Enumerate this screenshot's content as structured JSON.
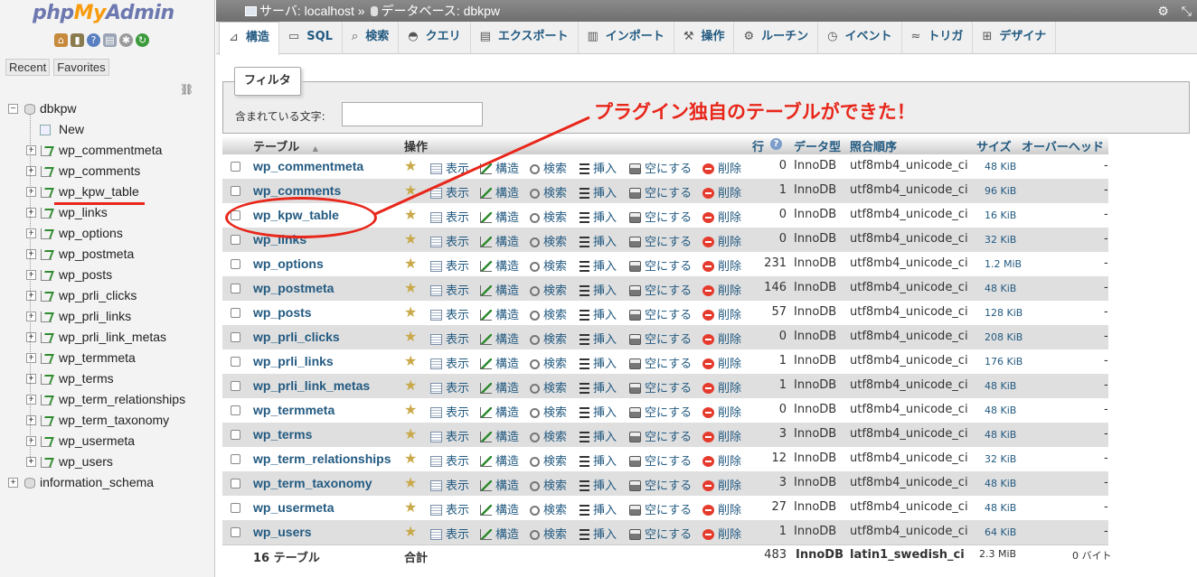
{
  "app": {
    "logo": {
      "php": "php",
      "my": "My",
      "admin": "Admin"
    },
    "nav_icons": [
      "home-icon",
      "logout-icon",
      "help-icon",
      "docs-icon",
      "settings-icon",
      "reload-icon"
    ],
    "recent_tabs": [
      "Recent",
      "Favorites"
    ]
  },
  "sidebar": {
    "databases": [
      {
        "name": "dbkpw",
        "expanded": true
      },
      {
        "name": "information_schema",
        "expanded": false
      }
    ],
    "new_label": "New",
    "tables": [
      "wp_commentmeta",
      "wp_comments",
      "wp_kpw_table",
      "wp_links",
      "wp_options",
      "wp_postmeta",
      "wp_posts",
      "wp_prli_clicks",
      "wp_prli_links",
      "wp_prli_link_metas",
      "wp_termmeta",
      "wp_terms",
      "wp_term_relationships",
      "wp_term_taxonomy",
      "wp_usermeta",
      "wp_users"
    ]
  },
  "breadcrumb": {
    "server": "サーバ: localhost",
    "sep": "»",
    "database": "データベース: dbkpw"
  },
  "tabs": [
    {
      "label": "構造",
      "icon": "structure-icon",
      "active": true
    },
    {
      "label": "SQL",
      "icon": "sql-icon"
    },
    {
      "label": "検索",
      "icon": "search-icon"
    },
    {
      "label": "クエリ",
      "icon": "query-icon"
    },
    {
      "label": "エクスポート",
      "icon": "export-icon"
    },
    {
      "label": "インポート",
      "icon": "import-icon"
    },
    {
      "label": "操作",
      "icon": "operations-icon"
    },
    {
      "label": "ルーチン",
      "icon": "routines-icon"
    },
    {
      "label": "イベント",
      "icon": "events-icon"
    },
    {
      "label": "トリガ",
      "icon": "triggers-icon"
    },
    {
      "label": "デザイナ",
      "icon": "designer-icon"
    }
  ],
  "filter": {
    "legend": "フィルタ",
    "label": "含まれている文字:",
    "value": ""
  },
  "annotation": "プラグイン独自のテーブルができた！",
  "table": {
    "headers": {
      "table": "テーブル",
      "sort_arrow": "▲",
      "action": "操作",
      "rows": "行",
      "type": "データ型",
      "collation": "照合順序",
      "size": "サイズ",
      "overhead": "オーバーヘッド"
    },
    "action_labels": {
      "browse": "表示",
      "structure": "構造",
      "search": "検索",
      "insert": "挿入",
      "empty": "空にする",
      "drop": "削除"
    },
    "rows": [
      {
        "name": "wp_commentmeta",
        "rows": "0",
        "type": "InnoDB",
        "collation": "utf8mb4_unicode_ci",
        "size": "48 KiB",
        "overhead": "-"
      },
      {
        "name": "wp_comments",
        "rows": "1",
        "type": "InnoDB",
        "collation": "utf8mb4_unicode_ci",
        "size": "96 KiB",
        "overhead": "-"
      },
      {
        "name": "wp_kpw_table",
        "rows": "0",
        "type": "InnoDB",
        "collation": "utf8mb4_unicode_ci",
        "size": "16 KiB",
        "overhead": "-"
      },
      {
        "name": "wp_links",
        "rows": "0",
        "type": "InnoDB",
        "collation": "utf8mb4_unicode_ci",
        "size": "32 KiB",
        "overhead": "-"
      },
      {
        "name": "wp_options",
        "rows": "231",
        "type": "InnoDB",
        "collation": "utf8mb4_unicode_ci",
        "size": "1.2 MiB",
        "overhead": "-"
      },
      {
        "name": "wp_postmeta",
        "rows": "146",
        "type": "InnoDB",
        "collation": "utf8mb4_unicode_ci",
        "size": "48 KiB",
        "overhead": "-"
      },
      {
        "name": "wp_posts",
        "rows": "57",
        "type": "InnoDB",
        "collation": "utf8mb4_unicode_ci",
        "size": "128 KiB",
        "overhead": "-"
      },
      {
        "name": "wp_prli_clicks",
        "rows": "0",
        "type": "InnoDB",
        "collation": "utf8mb4_unicode_ci",
        "size": "208 KiB",
        "overhead": "-"
      },
      {
        "name": "wp_prli_links",
        "rows": "1",
        "type": "InnoDB",
        "collation": "utf8mb4_unicode_ci",
        "size": "176 KiB",
        "overhead": "-"
      },
      {
        "name": "wp_prli_link_metas",
        "rows": "1",
        "type": "InnoDB",
        "collation": "utf8mb4_unicode_ci",
        "size": "48 KiB",
        "overhead": "-"
      },
      {
        "name": "wp_termmeta",
        "rows": "0",
        "type": "InnoDB",
        "collation": "utf8mb4_unicode_ci",
        "size": "48 KiB",
        "overhead": "-"
      },
      {
        "name": "wp_terms",
        "rows": "3",
        "type": "InnoDB",
        "collation": "utf8mb4_unicode_ci",
        "size": "48 KiB",
        "overhead": "-"
      },
      {
        "name": "wp_term_relationships",
        "rows": "12",
        "type": "InnoDB",
        "collation": "utf8mb4_unicode_ci",
        "size": "32 KiB",
        "overhead": "-"
      },
      {
        "name": "wp_term_taxonomy",
        "rows": "3",
        "type": "InnoDB",
        "collation": "utf8mb4_unicode_ci",
        "size": "48 KiB",
        "overhead": "-"
      },
      {
        "name": "wp_usermeta",
        "rows": "27",
        "type": "InnoDB",
        "collation": "utf8mb4_unicode_ci",
        "size": "48 KiB",
        "overhead": "-"
      },
      {
        "name": "wp_users",
        "rows": "1",
        "type": "InnoDB",
        "collation": "utf8mb4_unicode_ci",
        "size": "64 KiB",
        "overhead": "-"
      }
    ],
    "footer": {
      "count": "16 テーブル",
      "total_label": "合計",
      "rows": "483",
      "type": "InnoDB",
      "collation": "latin1_swedish_ci",
      "size": "2.3 MiB",
      "overhead": "0 バイト"
    }
  },
  "colors": {
    "link": "#235a81",
    "annotation": "#e8261a",
    "row_alt": "#dfdfdf"
  }
}
